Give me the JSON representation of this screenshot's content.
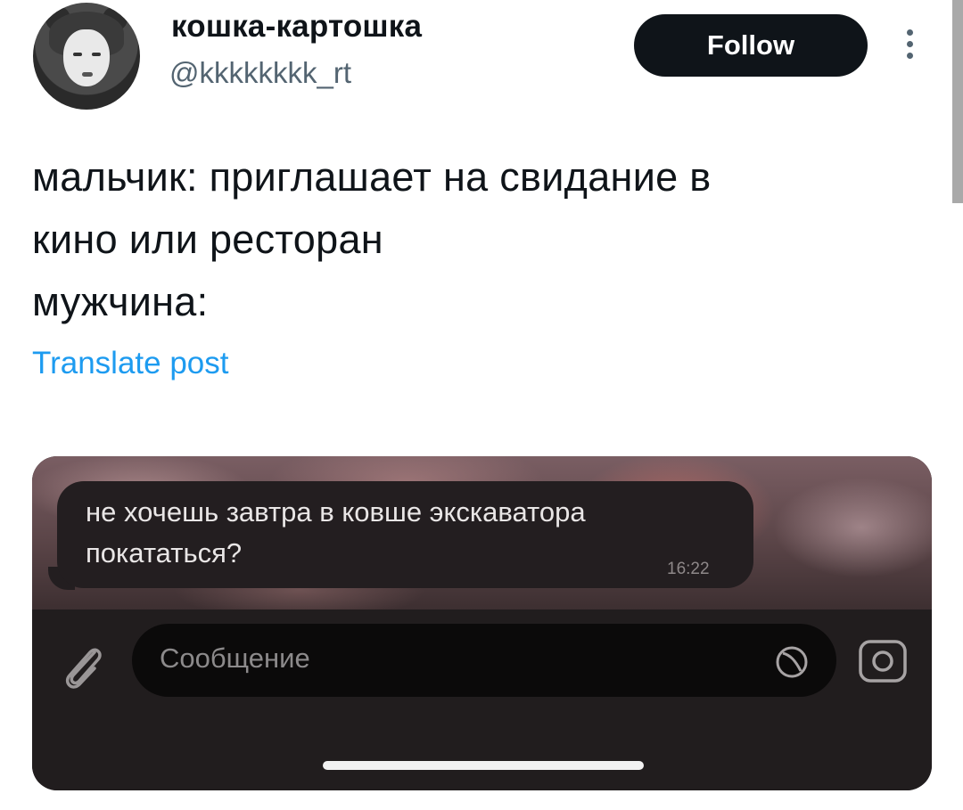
{
  "tweet": {
    "display_name": "кошка-картошка",
    "handle": "@kkkkkkkk_rt",
    "follow_label": "Follow",
    "text_lines": [
      "мальчик: приглашает на свидание в",
      "кино или ресторан",
      "мужчина:"
    ],
    "translate_label": "Translate post"
  },
  "media": {
    "message_lines": [
      "не хочешь завтра в ковше экскаватора",
      "покататься?"
    ],
    "message_time": "16:22",
    "input_placeholder": "Сообщение"
  },
  "colors": {
    "follow_button_bg": "#0f1419",
    "translate_link": "#1d9bf0",
    "handle_gray": "#536471",
    "chat_bg": "#211d1e"
  },
  "icons": {
    "more": "more-vertical-icon",
    "attach": "paperclip-icon",
    "sticker": "sticker-icon",
    "camera": "camera-icon"
  }
}
